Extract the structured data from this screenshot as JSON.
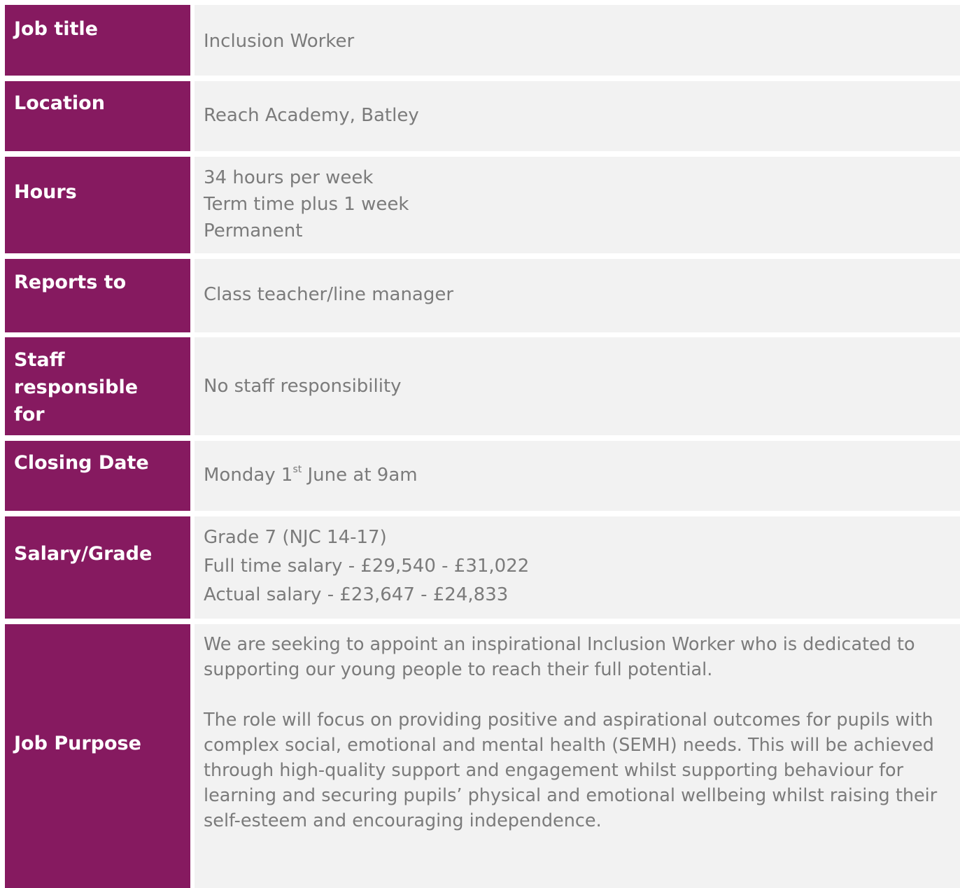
{
  "rows": [
    {
      "label": "Job title",
      "value": "Inclusion Worker"
    },
    {
      "label": "Location",
      "value": "Reach Academy, Batley"
    },
    {
      "label": "Hours",
      "lines": [
        "34 hours per week",
        "Term time plus 1 week",
        "Permanent"
      ]
    },
    {
      "label": "Reports to",
      "value": "Class teacher/line manager"
    },
    {
      "label_lines": [
        "Staff",
        "responsible",
        "for"
      ],
      "value": "No staff responsibility"
    },
    {
      "label": "Closing Date",
      "value_prefix": "Monday 1",
      "value_sup": "st",
      "value_suffix": " June at 9am"
    },
    {
      "label": "Salary/Grade",
      "lines": [
        "Grade 7 (NJC 14-17)",
        "Full time salary - £29,540 - £31,022",
        "Actual salary - £23,647 - £24,833"
      ]
    },
    {
      "label": "Job Purpose",
      "paragraphs": [
        "We are seeking to appoint an inspirational Inclusion Worker who is dedicated to supporting our young people to reach their full potential.",
        "The role will focus on providing positive and aspirational outcomes for pupils with complex social, emotional and mental health (SEMH) needs. This will be achieved through high-quality support and engagement whilst supporting behaviour for learning and securing pupils’ physical and emotional wellbeing whilst raising their self-esteem and encouraging independence."
      ]
    }
  ],
  "colors": {
    "label_bg": "#861a60",
    "label_text": "#ffffff",
    "value_bg": "#f2f2f2",
    "value_text": "#7b7b7b"
  }
}
